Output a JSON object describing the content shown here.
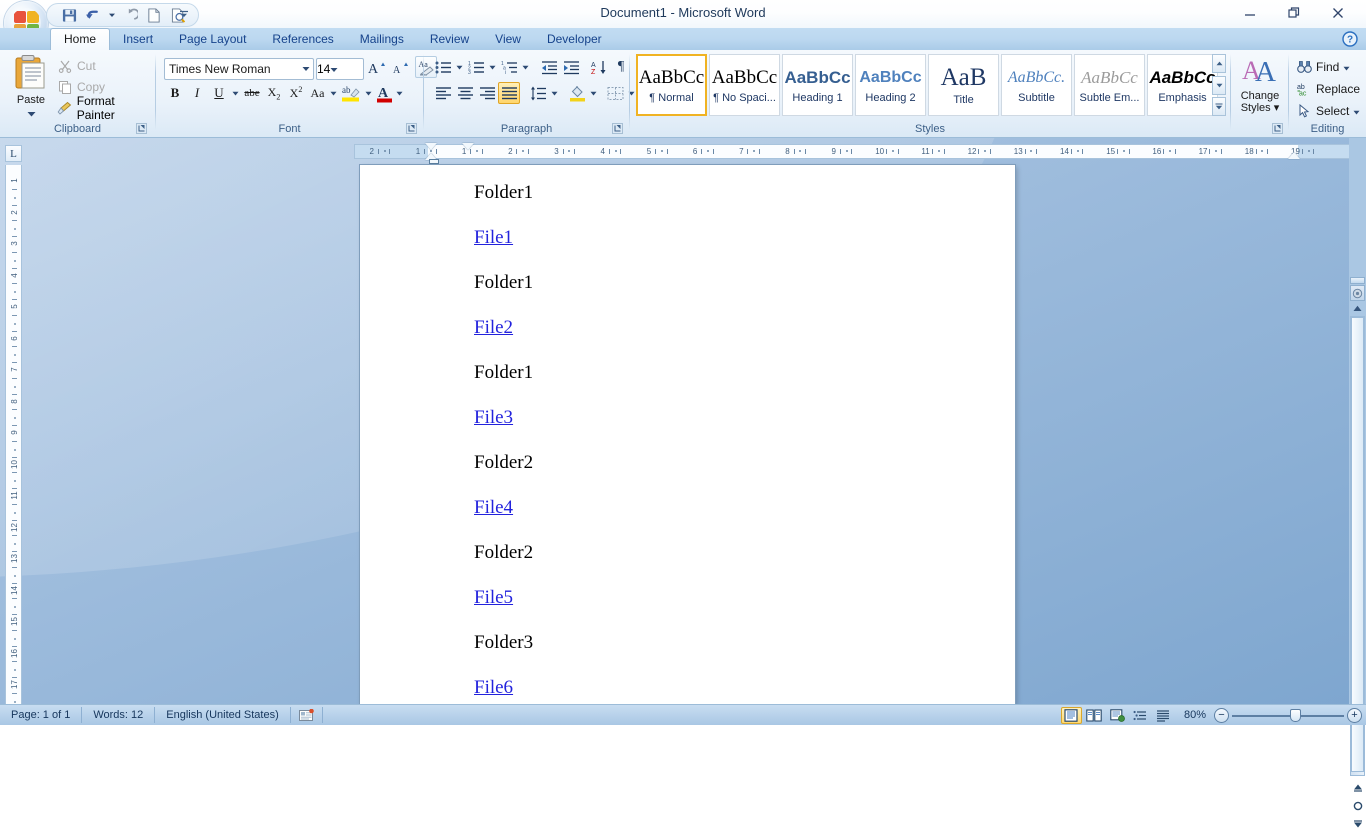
{
  "window": {
    "title": "Document1 - Microsoft Word",
    "minimize_label": "Minimize",
    "restore_label": "Restore Down",
    "close_label": "Close",
    "help_label": "Microsoft Office Word Help"
  },
  "quick_access": {
    "items": [
      {
        "name": "save-icon",
        "label": "Save"
      },
      {
        "name": "undo-icon",
        "label": "Undo"
      },
      {
        "name": "redo-icon",
        "label": "Redo"
      },
      {
        "name": "new-icon",
        "label": "New"
      },
      {
        "name": "print-preview-icon",
        "label": "Print Preview"
      }
    ],
    "customize_label": "Customize Quick Access Toolbar"
  },
  "tabs": [
    {
      "label": "Home",
      "active": true
    },
    {
      "label": "Insert",
      "active": false
    },
    {
      "label": "Page Layout",
      "active": false
    },
    {
      "label": "References",
      "active": false
    },
    {
      "label": "Mailings",
      "active": false
    },
    {
      "label": "Review",
      "active": false
    },
    {
      "label": "View",
      "active": false
    },
    {
      "label": "Developer",
      "active": false
    }
  ],
  "ribbon": {
    "clipboard": {
      "group_label": "Clipboard",
      "paste_label": "Paste",
      "cut_label": "Cut",
      "copy_label": "Copy",
      "format_painter_label": "Format Painter"
    },
    "font": {
      "group_label": "Font",
      "font_family_value": "Times New Roman",
      "font_size_value": "14",
      "grow_font_label": "Grow Font",
      "shrink_font_label": "Shrink Font",
      "clear_formatting_label": "Clear Formatting",
      "bold_label": "B",
      "italic_label": "I",
      "underline_label": "U",
      "strikethrough_label": "abe",
      "subscript_label": "X",
      "superscript_label": "X",
      "change_case_label": "Aa",
      "highlight_label": "Text Highlight Color",
      "font_color_label": "A"
    },
    "paragraph": {
      "group_label": "Paragraph",
      "bullets_label": "Bullets",
      "numbering_label": "Numbering",
      "multilevel_label": "Multilevel List",
      "decrease_indent_label": "Decrease Indent",
      "increase_indent_label": "Increase Indent",
      "sort_label": "Sort",
      "show_marks_label": "¶",
      "align_left_label": "Align Text Left",
      "center_label": "Center",
      "align_right_label": "Align Text Right",
      "justify_label": "Justify",
      "line_spacing_label": "Line Spacing",
      "shading_label": "Shading",
      "borders_label": "Borders"
    },
    "styles": {
      "group_label": "Styles",
      "items": [
        {
          "preview": "AaBbCc",
          "name": "¶ Normal",
          "selected": true
        },
        {
          "preview": "AaBbCc",
          "name": "¶ No Spaci...",
          "selected": false
        },
        {
          "preview": "AaBbCc",
          "name": "Heading 1",
          "selected": false
        },
        {
          "preview": "AaBbCc",
          "name": "Heading 2",
          "selected": false
        },
        {
          "preview": "AaB",
          "name": "Title",
          "selected": false
        },
        {
          "preview": "AaBbCc.",
          "name": "Subtitle",
          "selected": false
        },
        {
          "preview": "AaBbCc",
          "name": "Subtle Em...",
          "selected": false
        },
        {
          "preview": "AaBbCc",
          "name": "Emphasis",
          "selected": false
        }
      ],
      "scroll_up_label": "Previous row",
      "scroll_down_label": "Next row",
      "more_label": "More"
    },
    "change_styles": {
      "label_line1": "Change",
      "label_line2": "Styles"
    },
    "editing": {
      "group_label": "Editing",
      "find_label": "Find",
      "replace_label": "Replace",
      "select_label": "Select"
    }
  },
  "ruler": {
    "tab_stop_marker": "L",
    "horizontal_ticks": [
      "2",
      "1",
      "1",
      "2",
      "3",
      "4",
      "5",
      "6",
      "7",
      "8",
      "9",
      "10",
      "11",
      "12",
      "13",
      "14",
      "15",
      "16",
      "17",
      "18",
      "19"
    ],
    "vertical_ticks": [
      "1",
      "2",
      "3",
      "4",
      "5",
      "6",
      "7",
      "8",
      "9",
      "10",
      "11",
      "12",
      "13",
      "14",
      "15",
      "16",
      "17"
    ]
  },
  "document": {
    "lines": [
      {
        "text": "Folder1",
        "type": "text"
      },
      {
        "text": "File1",
        "type": "link"
      },
      {
        "text": "Folder1",
        "type": "text"
      },
      {
        "text": "File2",
        "type": "link"
      },
      {
        "text": "Folder1",
        "type": "text"
      },
      {
        "text": "File3",
        "type": "link"
      },
      {
        "text": "Folder2",
        "type": "text"
      },
      {
        "text": "File4",
        "type": "link"
      },
      {
        "text": "Folder2",
        "type": "text"
      },
      {
        "text": "File5",
        "type": "link"
      },
      {
        "text": "Folder3",
        "type": "text"
      },
      {
        "text": "File6",
        "type": "link"
      }
    ],
    "link_color": "#2222dd",
    "text_color": "#000000"
  },
  "status_bar": {
    "page_label": "Page: 1 of 1",
    "words_label": "Words: 12",
    "language_label": "English (United States)",
    "proofing_icon_label": "Proofing errors",
    "views": [
      {
        "name": "print-layout-view",
        "selected": true
      },
      {
        "name": "full-screen-reading-view",
        "selected": false
      },
      {
        "name": "web-layout-view",
        "selected": false
      },
      {
        "name": "outline-view",
        "selected": false
      },
      {
        "name": "draft-view",
        "selected": false
      }
    ],
    "zoom_value": "80%",
    "zoom_out_label": "−",
    "zoom_in_label": "+"
  },
  "scrollbar": {
    "split_label": "Split",
    "select_object_label": "Select Browse Object",
    "prev_label": "Previous Page",
    "next_label": "Next Page"
  }
}
